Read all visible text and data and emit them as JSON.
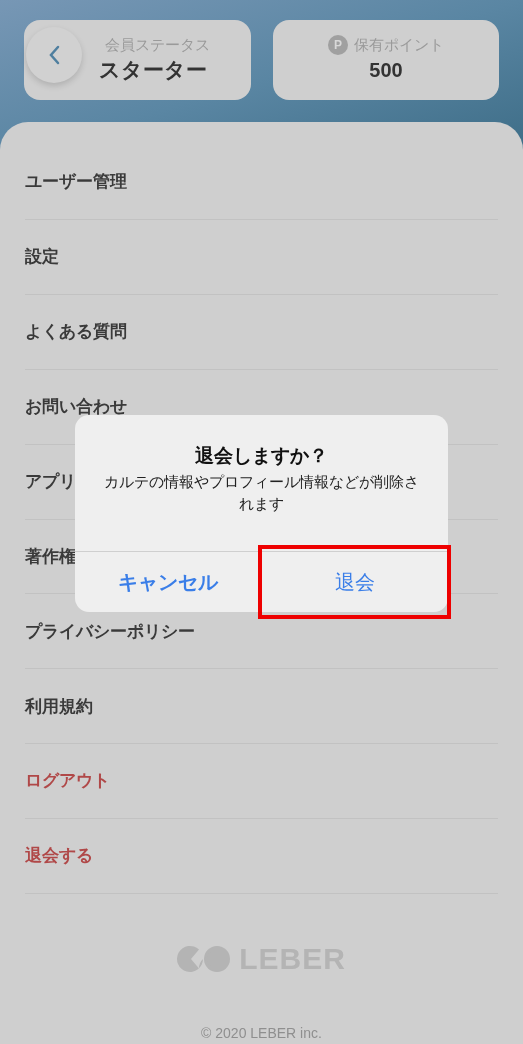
{
  "header": {
    "status_card": {
      "label": "会員ステータス",
      "value": "スターター"
    },
    "points_card": {
      "badge": "P",
      "label": "保有ポイント",
      "value": "500"
    }
  },
  "menu": [
    {
      "label": "ユーザー管理",
      "kind": "normal"
    },
    {
      "label": "設定",
      "kind": "normal"
    },
    {
      "label": "よくある質問",
      "kind": "normal"
    },
    {
      "label": "お問い合わせ",
      "kind": "normal"
    },
    {
      "label": "アプリ",
      "kind": "normal"
    },
    {
      "label": "著作権",
      "kind": "normal"
    },
    {
      "label": "プライバシーポリシー",
      "kind": "normal"
    },
    {
      "label": "利用規約",
      "kind": "normal"
    },
    {
      "label": "ログアウト",
      "kind": "danger"
    },
    {
      "label": "退会する",
      "kind": "danger"
    }
  ],
  "footer": {
    "logo": "LEBER",
    "copyright": "© 2020 LEBER inc."
  },
  "dialog": {
    "title": "退会しますか？",
    "message": "カルテの情報やプロフィール情報などが削除されます",
    "buttons": [
      {
        "label": "キャンセル",
        "kind": "cancel",
        "highlighted": false
      },
      {
        "label": "退会",
        "kind": "confirm",
        "highlighted": true
      }
    ]
  }
}
